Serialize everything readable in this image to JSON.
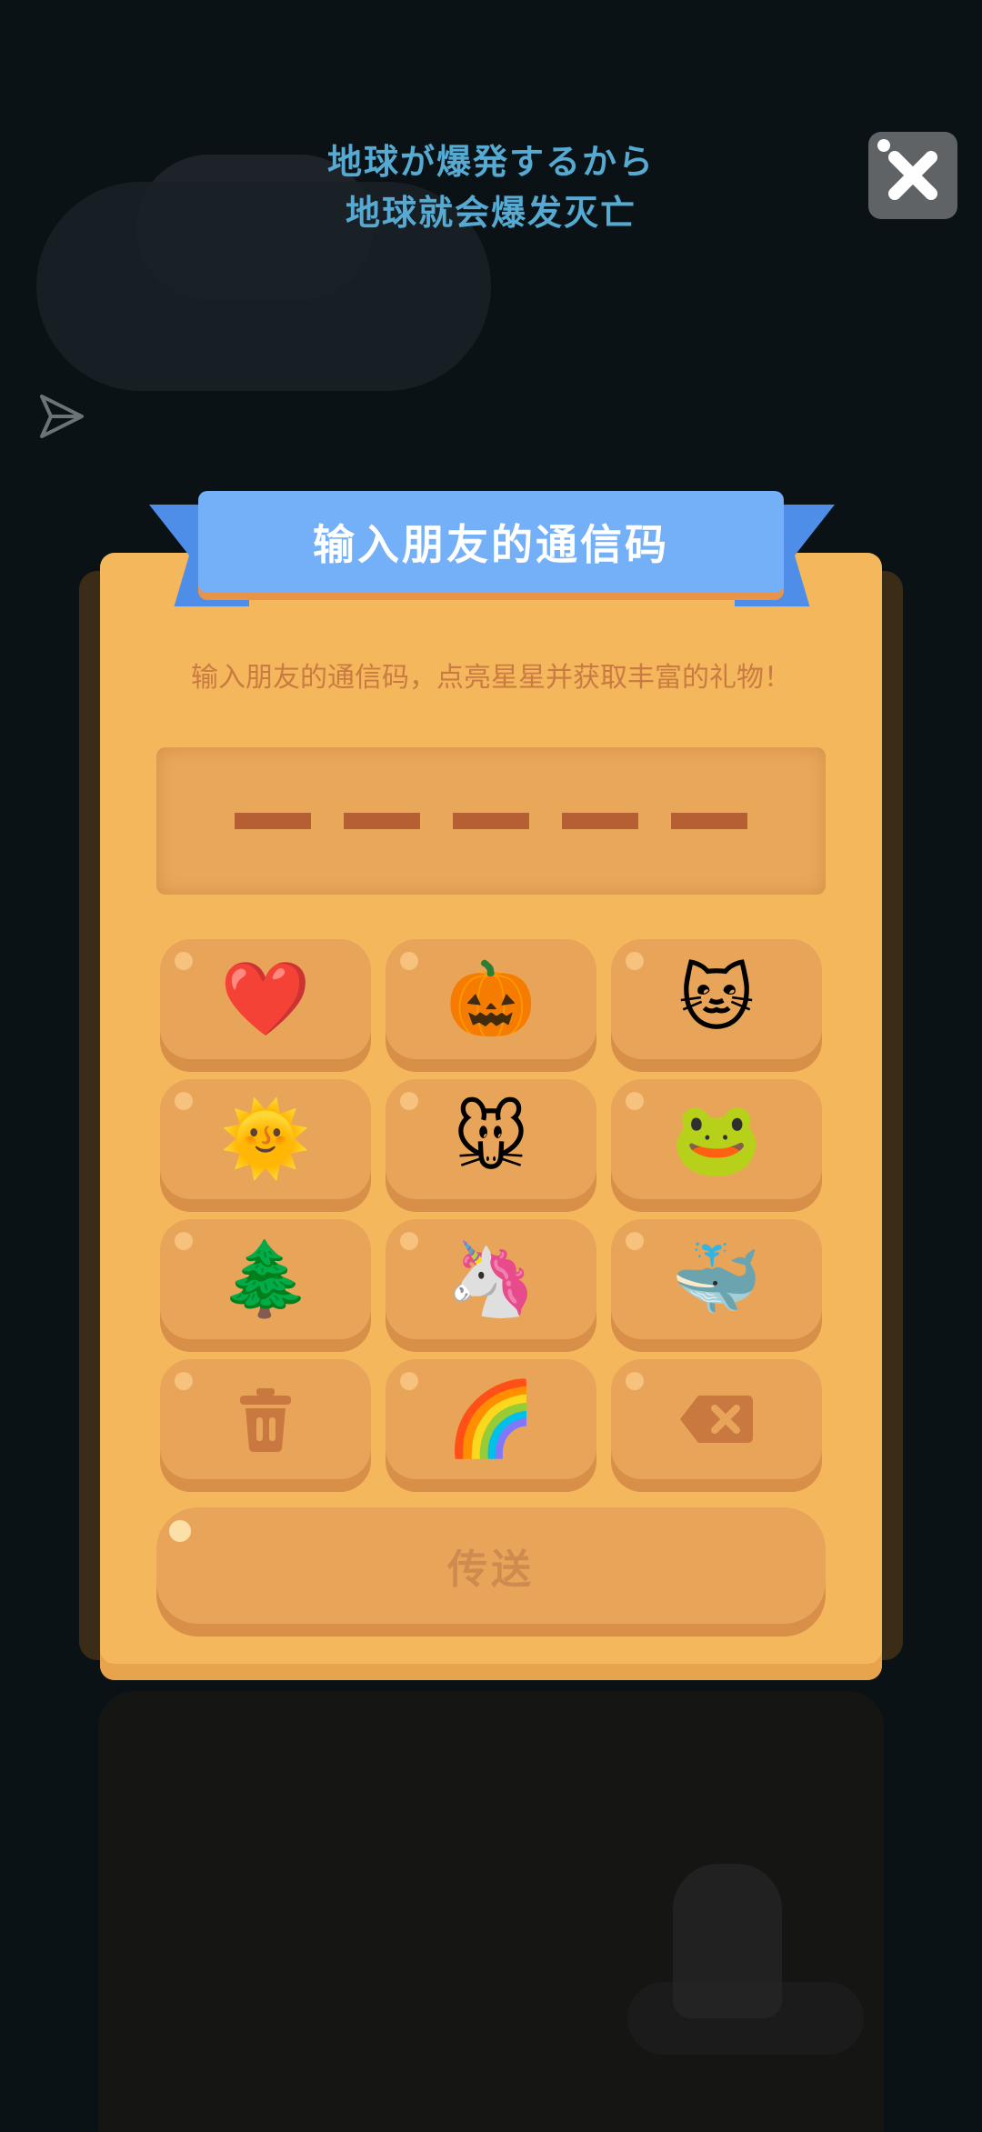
{
  "header": {
    "line1": "地球が爆発するから",
    "line2": "地球就会爆发灭亡"
  },
  "icons": {
    "close": "close-icon",
    "share": "send-icon"
  },
  "dialog": {
    "title": "输入朋友的通信码",
    "subtitle": "输入朋友的通信码，点亮星星并获取丰富的礼物！",
    "code_slots": 5,
    "keys": [
      {
        "name": "heart",
        "glyph": "❤️"
      },
      {
        "name": "pumpkin",
        "glyph": "🎃"
      },
      {
        "name": "cat",
        "glyph": "🐱"
      },
      {
        "name": "sun",
        "glyph": "🌞"
      },
      {
        "name": "mouse",
        "glyph": "🐭"
      },
      {
        "name": "frog",
        "glyph": "🐸"
      },
      {
        "name": "tree",
        "glyph": "🌲"
      },
      {
        "name": "unicorn",
        "glyph": "🦄"
      },
      {
        "name": "whale",
        "glyph": "🐳"
      },
      {
        "name": "trash",
        "glyph": ""
      },
      {
        "name": "rainbow",
        "glyph": "🌈"
      },
      {
        "name": "backspace",
        "glyph": ""
      }
    ],
    "send_label": "传送"
  },
  "colors": {
    "panel": "#f4b75c",
    "ribbon": "#74b0f8",
    "key": "#e8a55a",
    "accent_text": "#c97b42",
    "header_text": "#56a9d1"
  }
}
